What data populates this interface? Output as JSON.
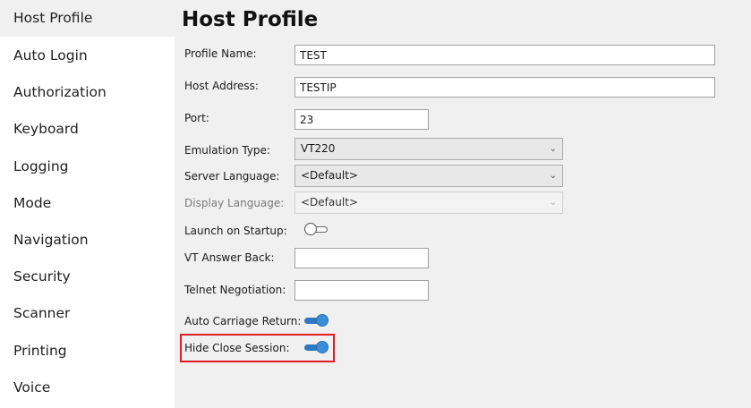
{
  "sidebar": {
    "items": [
      {
        "label": "Host Profile",
        "selected": true
      },
      {
        "label": "Auto Login"
      },
      {
        "label": "Authorization"
      },
      {
        "label": "Keyboard"
      },
      {
        "label": "Logging"
      },
      {
        "label": "Mode"
      },
      {
        "label": "Navigation"
      },
      {
        "label": "Security"
      },
      {
        "label": "Scanner"
      },
      {
        "label": "Printing"
      },
      {
        "label": "Voice"
      }
    ]
  },
  "main": {
    "title": "Host Profile",
    "fields": {
      "profile_name": {
        "label": "Profile Name:",
        "value": "TEST"
      },
      "host_address": {
        "label": "Host Address:",
        "value": "TESTIP"
      },
      "port": {
        "label": "Port:",
        "value": "23"
      },
      "emulation_type": {
        "label": "Emulation Type:",
        "value": "VT220"
      },
      "server_language": {
        "label": "Server Language:",
        "value": "<Default>"
      },
      "display_language": {
        "label": "Display Language:",
        "value": "<Default>",
        "disabled": true
      },
      "launch_on_startup": {
        "label": "Launch on Startup:",
        "on": false
      },
      "vt_answer_back": {
        "label": "VT Answer Back:",
        "value": ""
      },
      "telnet_negotiation": {
        "label": "Telnet Negotiation:",
        "value": ""
      },
      "auto_carriage_return": {
        "label": "Auto Carriage Return:",
        "on": true
      },
      "hide_close_session": {
        "label": "Hide Close Session:",
        "on": true,
        "highlighted": true
      }
    }
  },
  "colors": {
    "accent": "#2f78c2",
    "highlight": "#e01b24",
    "sidebar_bg": "#ffffff",
    "panel_bg": "#f0f0f0"
  },
  "icons": {
    "dropdown": "chevron-down-icon"
  }
}
